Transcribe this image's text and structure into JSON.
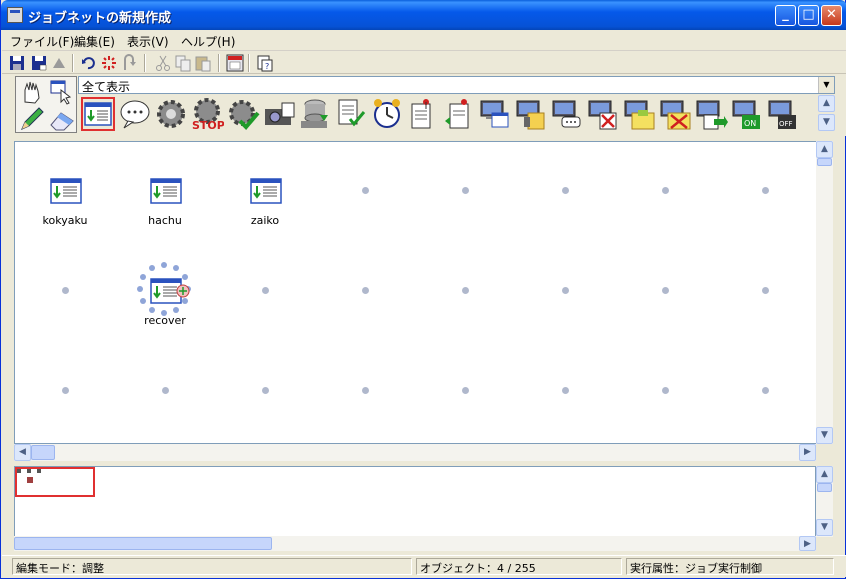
{
  "window": {
    "title": "ジョブネットの新規作成"
  },
  "menu": {
    "items": [
      "ファイル(F)",
      "編集(E)",
      "表示(V)",
      "ヘルプ(H)"
    ]
  },
  "filter": {
    "selected": "全て表示"
  },
  "jobs": [
    {
      "label": "kokyaku"
    },
    {
      "label": "hachu"
    },
    {
      "label": "zaiko"
    },
    {
      "label": "recover"
    }
  ],
  "status": {
    "mode": "編集モード：調整",
    "objects": "オブジェクト：4 / 255",
    "attribute": "実行属性：ジョブ実行制御"
  },
  "icons": {
    "palette": [
      "job-icon",
      "message-icon",
      "gear-icon",
      "stop-gear-icon",
      "check-gear-icon",
      "camera-icon",
      "database-icon",
      "document-check-icon",
      "alarm-clock-icon",
      "doc-pin-icon",
      "doc-pin2-icon",
      "pc-icon",
      "pc-jobnet-icon",
      "pc-message-icon",
      "pc-delete-icon",
      "pc-folder-icon",
      "pc-folder-delete-icon",
      "pc-transfer-icon",
      "pc-on-icon",
      "pc-off-icon"
    ]
  },
  "colors": {
    "selection": "#e03030",
    "titlebar": "#0559ea",
    "grid": "#b0b8cc"
  }
}
